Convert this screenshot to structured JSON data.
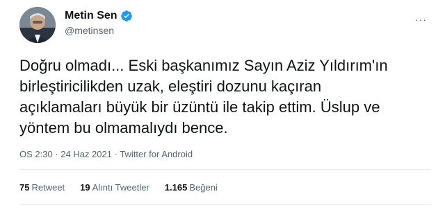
{
  "author": {
    "name": "Metin Sen",
    "handle": "@metinsen",
    "verified": true
  },
  "tweet": {
    "text": "Doğru olmadı... Eski başkanımız Sayın Aziz Yıldırım'ın\nbirleştiricilikden uzak, eleştiri dozunu kaçıran\naçıklamaları büyük bir üzüntü ile takip ettim. Üslup ve\nyöntem bu olmamalıydı bence.",
    "timestamp": "ÖS 2:30 · 24 Haz 2021 · Twitter for Android"
  },
  "stats": {
    "retweets": {
      "count": "75",
      "label": "Retweet"
    },
    "quotes": {
      "count": "19",
      "label": "Alıntı Tweetler"
    },
    "likes": {
      "count": "1.165",
      "label": "Beğeni"
    }
  },
  "icons": {
    "more": "more-options-icon",
    "verified": "verified-badge-icon"
  },
  "colors": {
    "verified_blue": "#1d9bf0",
    "secondary_text": "#536471",
    "primary_text": "#0f1419"
  }
}
